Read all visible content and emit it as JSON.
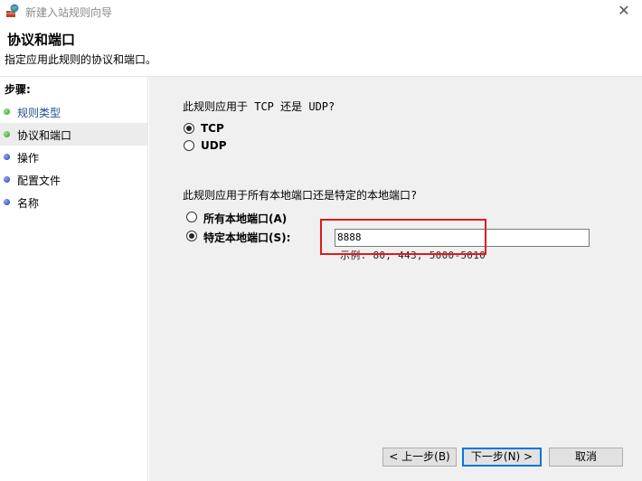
{
  "window": {
    "title": "新建入站规则向导",
    "close_glyph": "✕"
  },
  "header": {
    "title": "协议和端口",
    "subtitle": "指定应用此规则的协议和端口。"
  },
  "sidebar": {
    "steps_label": "步骤:",
    "items": [
      {
        "label": "规则类型",
        "state": "done"
      },
      {
        "label": "协议和端口",
        "state": "current"
      },
      {
        "label": "操作",
        "state": "pending"
      },
      {
        "label": "配置文件",
        "state": "pending"
      },
      {
        "label": "名称",
        "state": "pending"
      }
    ]
  },
  "protocol": {
    "question": "此规则应用于 TCP 还是 UDP?",
    "options": [
      {
        "label": "TCP",
        "selected": true
      },
      {
        "label": "UDP",
        "selected": false
      }
    ]
  },
  "ports": {
    "question": "此规则应用于所有本地端口还是特定的本地端口?",
    "options": [
      {
        "label": "所有本地端口(A)",
        "selected": false
      },
      {
        "label": "特定本地端口(S):",
        "selected": true
      }
    ],
    "value": "8888",
    "example": "示例: 80, 443, 5000-5010"
  },
  "footer": {
    "back_label": "< 上一步(B)",
    "next_label": "下一步(N) >",
    "cancel_label": "取消"
  },
  "colors": {
    "highlight": "#e01a1a",
    "focus_border": "#0078d7"
  }
}
